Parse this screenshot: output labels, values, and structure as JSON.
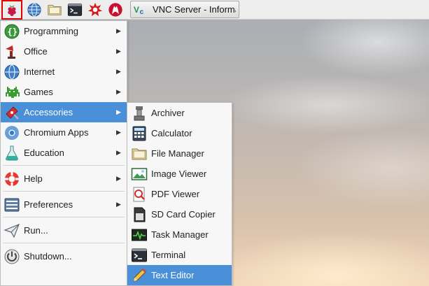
{
  "taskbar": {
    "launchers": [
      {
        "icon": "raspberry-menu-icon",
        "active": true
      },
      {
        "icon": "web-browser-icon"
      },
      {
        "icon": "file-manager-icon"
      },
      {
        "icon": "terminal-icon"
      },
      {
        "icon": "wolfram-icon"
      },
      {
        "icon": "mathematica-icon"
      }
    ],
    "task": {
      "icon": "vnc-icon",
      "label": "VNC Server - Informa..."
    }
  },
  "main_menu": {
    "items": [
      {
        "label": "Programming",
        "icon": "programming-icon",
        "submenu": true
      },
      {
        "label": "Office",
        "icon": "office-icon",
        "submenu": true
      },
      {
        "label": "Internet",
        "icon": "internet-globe-icon",
        "submenu": true
      },
      {
        "label": "Games",
        "icon": "games-icon",
        "submenu": true
      },
      {
        "label": "Accessories",
        "icon": "accessories-icon",
        "submenu": true,
        "highlighted": true
      },
      {
        "label": "Chromium Apps",
        "icon": "chromium-icon",
        "submenu": true
      },
      {
        "label": "Education",
        "icon": "education-icon",
        "submenu": true
      },
      {
        "label": "Help",
        "icon": "help-icon",
        "submenu": true
      },
      {
        "label": "Preferences",
        "icon": "preferences-icon",
        "submenu": true
      },
      {
        "label": "Run...",
        "icon": "run-icon",
        "submenu": false
      },
      {
        "label": "Shutdown...",
        "icon": "shutdown-icon",
        "submenu": false
      }
    ]
  },
  "accessories_menu": {
    "items": [
      {
        "label": "Archiver",
        "icon": "archiver-icon"
      },
      {
        "label": "Calculator",
        "icon": "calculator-icon"
      },
      {
        "label": "File Manager",
        "icon": "folder-icon"
      },
      {
        "label": "Image Viewer",
        "icon": "image-viewer-icon"
      },
      {
        "label": "PDF Viewer",
        "icon": "pdf-viewer-icon"
      },
      {
        "label": "SD Card Copier",
        "icon": "sd-card-icon"
      },
      {
        "label": "Task Manager",
        "icon": "task-manager-icon"
      },
      {
        "label": "Terminal",
        "icon": "terminal-icon"
      },
      {
        "label": "Text Editor",
        "icon": "text-editor-icon",
        "highlighted": true
      }
    ]
  },
  "colors": {
    "highlight": "#4a90d9",
    "menu_bg": "#f7f7f7",
    "taskbar_bg": "#ededed",
    "active_border": "#e00000"
  }
}
